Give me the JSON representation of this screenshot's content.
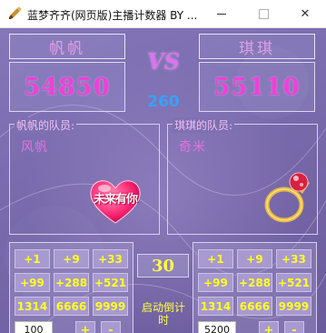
{
  "window": {
    "title": "蓝梦齐齐(网页版)主播计数器 BY ...",
    "minimize": "—",
    "maximize": "□",
    "close": "✕",
    "icon": "paintbrush-icon"
  },
  "teams": {
    "left": {
      "name": "帆帆",
      "score": "54850",
      "members_label": "帆帆的队员:",
      "member": "风帆",
      "sticker_text": "未来有你",
      "sticker_icon": "heart-icon"
    },
    "right": {
      "name": "琪琪",
      "score": "55110",
      "members_label": "琪琪的队员:",
      "member": "奇米",
      "sticker_icon": "ring-icon"
    }
  },
  "vs_label": "VS",
  "difference": "260",
  "gift_buttons": {
    "left": [
      "+1",
      "+9",
      "+33",
      "+99",
      "+288",
      "+521",
      "1314",
      "6666",
      "9999"
    ],
    "right": [
      "+1",
      "+9",
      "+33",
      "+99",
      "+288",
      "+521",
      "1314",
      "6666",
      "9999"
    ]
  },
  "custom": {
    "left_value": "100",
    "right_value": "5200",
    "plus": "+",
    "minus": "-"
  },
  "timer": {
    "value": "30",
    "start_label": "启动倒计时"
  },
  "colors": {
    "accent_pink": "#f040d8",
    "button_text": "#ffff20",
    "diff_blue": "#3aa0f8"
  }
}
